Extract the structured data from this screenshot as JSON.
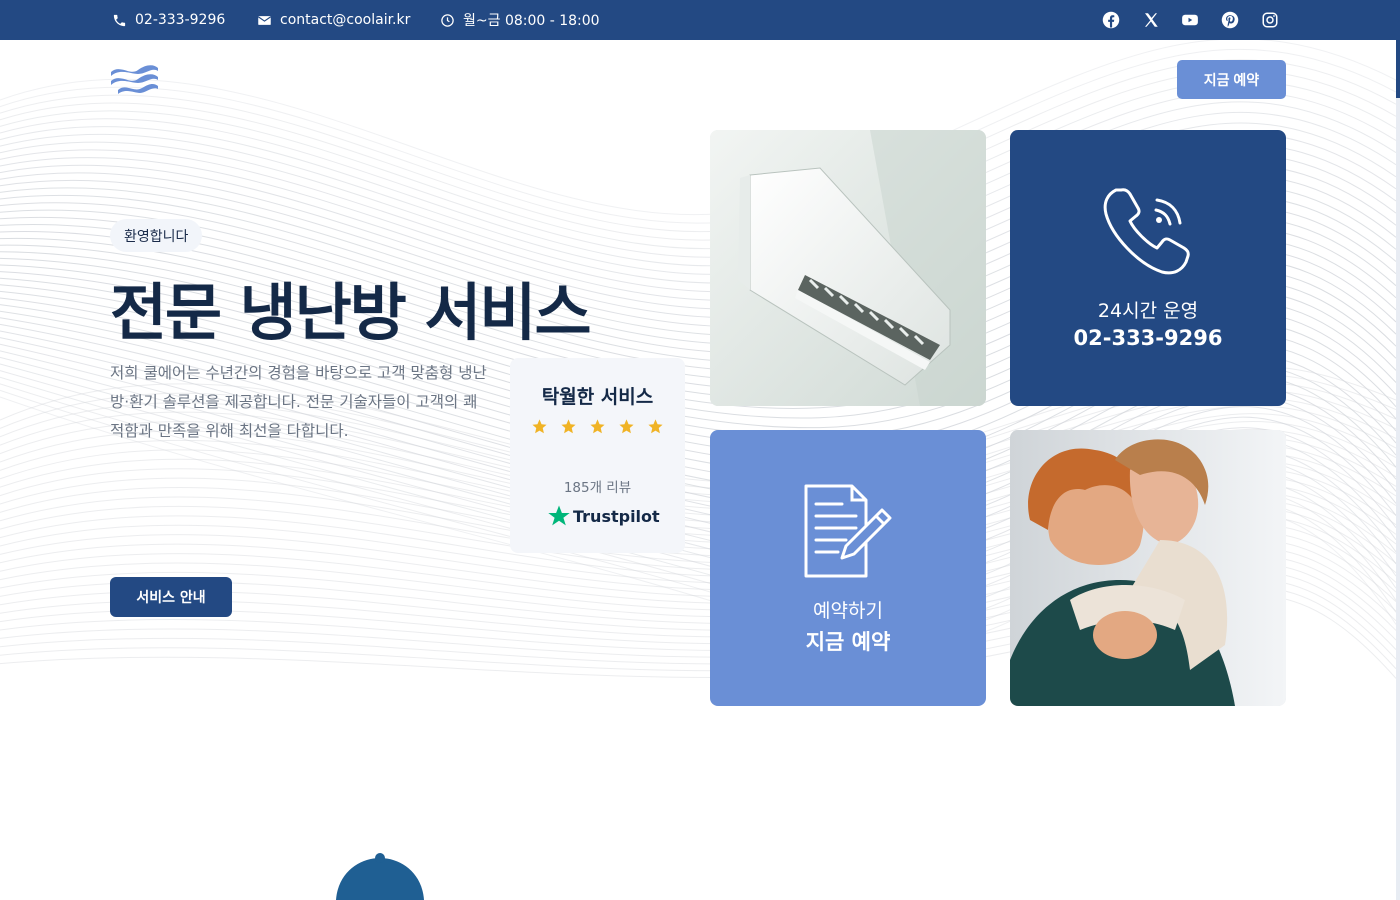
{
  "topbar": {
    "phone": "02-333-9296",
    "email": "contact@coolair.kr",
    "hours": "월~금 08:00 - 18:00",
    "social_icons": [
      "facebook-icon",
      "x-icon",
      "youtube-icon",
      "pinterest-icon",
      "instagram-icon"
    ]
  },
  "header": {
    "book_now": "지금 예약"
  },
  "hero": {
    "badge": "환영합니다",
    "title": "전문 냉난방 서비스",
    "description": "저희 쿨에어는 수년간의 경험을 바탕으로 고객 맞춤형 냉난방·환기 솔루션을 제공합니다. 전문 기술자들이 고객의 쾌적함과 만족을 위해 최선을 다합니다.",
    "services_button": "서비스 안내"
  },
  "review_card": {
    "title": "탁월한 서비스",
    "rating": 5,
    "count": "185개 리뷰",
    "platform": "Trustpilot"
  },
  "cards": {
    "phone": {
      "label": "24시간 운영",
      "value": "02-333-9296"
    },
    "booking": {
      "label": "예약하기",
      "value": "지금 예약"
    }
  },
  "colors": {
    "primary": "#234983",
    "accent": "#6a8fd6",
    "star": "#f0b325",
    "trustpilot": "#00b67a"
  }
}
